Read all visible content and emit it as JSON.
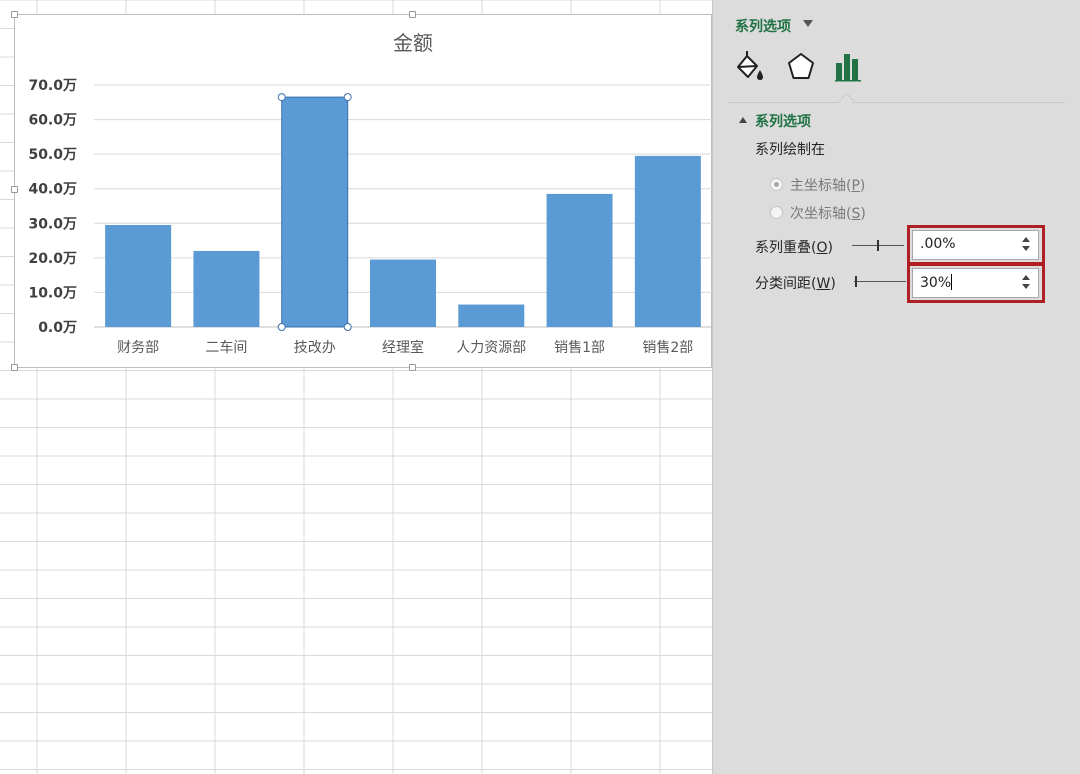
{
  "chart_data": {
    "type": "bar",
    "title": "金额",
    "categories": [
      "财务部",
      "二车间",
      "技改办",
      "经理室",
      "人力资源部",
      "销售1部",
      "销售2部"
    ],
    "values": [
      29.5,
      22.0,
      66.5,
      19.5,
      6.5,
      38.5,
      49.5
    ],
    "ylim": [
      0,
      70
    ],
    "yticks": [
      "0.0万",
      "10.0万",
      "20.0万",
      "30.0万",
      "40.0万",
      "50.0万",
      "60.0万",
      "70.0万"
    ],
    "grid": true,
    "legend": "none",
    "selected_category": "技改办",
    "bar_color": "#5b9bd5"
  },
  "pane": {
    "title": "系列选项",
    "tabs": [
      {
        "icon": "fill-bucket-icon"
      },
      {
        "icon": "pentagon-effects-icon"
      },
      {
        "icon": "bar-chart-options-icon",
        "active": true
      }
    ],
    "section_title": "系列选项",
    "plot_on_label": "系列绘制在",
    "primary_axis": {
      "label": "主坐标轴(",
      "key": "P",
      "close": ")",
      "checked": true
    },
    "secondary_axis": {
      "label": "次坐标轴(",
      "key": "S",
      "close": ")",
      "checked": false
    },
    "overlap": {
      "label": "系列重叠(",
      "key": "O",
      "close": ")",
      "value": ".00%"
    },
    "gap_width": {
      "label": "分类间距(",
      "key": "W",
      "close": ")",
      "value": "30%"
    }
  },
  "colors": {
    "accent": "#217346",
    "highlight": "#b01f24",
    "bar": "#5b9bd5",
    "pane_bg": "#dcdcdc"
  }
}
